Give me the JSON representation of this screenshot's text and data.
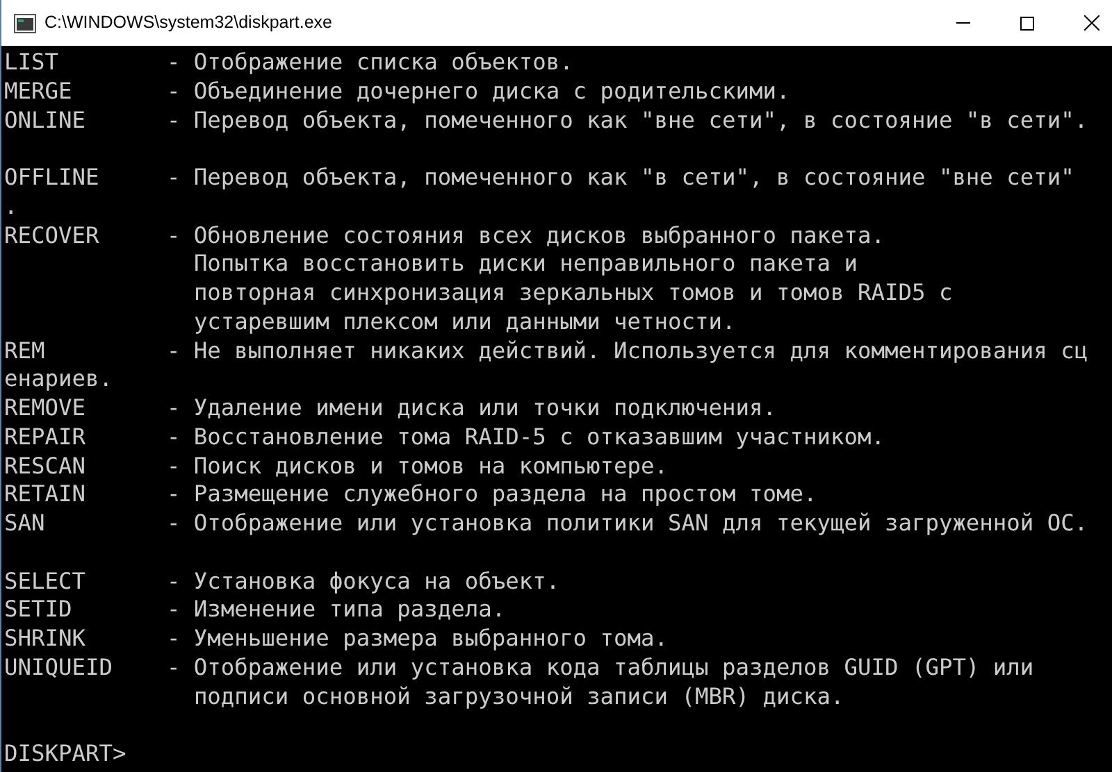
{
  "window": {
    "title": "C:\\WINDOWS\\system32\\diskpart.exe"
  },
  "console": {
    "lines": [
      {
        "kind": "entry",
        "command": "LIST",
        "description": "- Отображение списка объектов."
      },
      {
        "kind": "entry",
        "command": "MERGE",
        "description": "- Объединение дочернего диска с родительскими."
      },
      {
        "kind": "entry",
        "command": "ONLINE",
        "description": "- Перевод объекта, помеченного как \"вне сети\", в состояние \"в сети\"."
      },
      {
        "kind": "blank"
      },
      {
        "kind": "entry",
        "command": "OFFLINE",
        "description": "- Перевод объекта, помеченного как \"в сети\", в состояние \"вне сети\""
      },
      {
        "kind": "wrap",
        "text": "."
      },
      {
        "kind": "entry",
        "command": "RECOVER",
        "description": "- Обновление состояния всех дисков выбранного пакета."
      },
      {
        "kind": "continuation",
        "text": "Попытка восстановить диски неправильного пакета и"
      },
      {
        "kind": "continuation",
        "text": "повторная синхронизация зеркальных томов и томов RAID5 с"
      },
      {
        "kind": "continuation",
        "text": "устаревшим плексом или данными четности."
      },
      {
        "kind": "entry",
        "command": "REM",
        "description": "- Не выполняет никаких действий. Используется для комментирования сц"
      },
      {
        "kind": "wrap",
        "text": "енариев."
      },
      {
        "kind": "entry",
        "command": "REMOVE",
        "description": "- Удаление имени диска или точки подключения."
      },
      {
        "kind": "entry",
        "command": "REPAIR",
        "description": "- Восстановление тома RAID-5 с отказавшим участником."
      },
      {
        "kind": "entry",
        "command": "RESCAN",
        "description": "- Поиск дисков и томов на компьютере."
      },
      {
        "kind": "entry",
        "command": "RETAIN",
        "description": "- Размещение служебного раздела на простом томе."
      },
      {
        "kind": "entry",
        "command": "SAN",
        "description": "- Отображение или установка политики SAN для текущей загруженной ОС."
      },
      {
        "kind": "blank"
      },
      {
        "kind": "entry",
        "command": "SELECT",
        "description": "- Установка фокуса на объект."
      },
      {
        "kind": "entry",
        "command": "SETID",
        "description": "- Изменение типа раздела."
      },
      {
        "kind": "entry",
        "command": "SHRINK",
        "description": "- Уменьшение размера выбранного тома."
      },
      {
        "kind": "entry",
        "command": "UNIQUEID",
        "description": "- Отображение или установка кода таблицы разделов GUID (GPT) или"
      },
      {
        "kind": "continuation",
        "text": "подписи основной загрузочной записи (MBR) диска."
      },
      {
        "kind": "blank"
      },
      {
        "kind": "prompt",
        "text": "DISKPART>"
      }
    ]
  }
}
